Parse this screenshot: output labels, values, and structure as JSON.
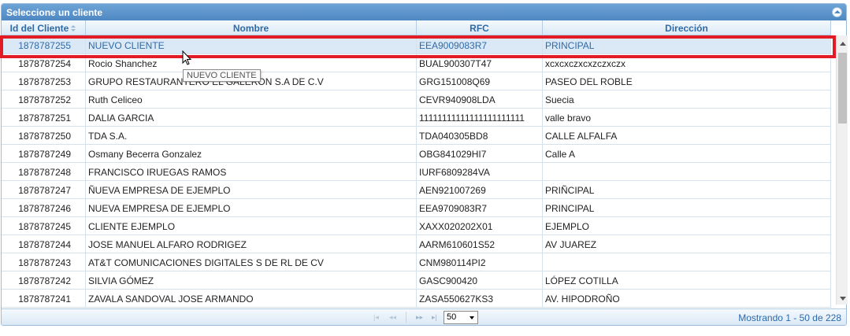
{
  "title": "Seleccione un cliente",
  "columns": {
    "id": "Id del Cliente",
    "name": "Nombre",
    "rfc": "RFC",
    "address": "Dirección"
  },
  "rows": [
    {
      "id": "1878787255",
      "name": "NUEVO CLIENTE",
      "rfc": "EEA9009083R7",
      "address": "PRINCIPAL",
      "selected": true
    },
    {
      "id": "1878787254",
      "name": "Rocio Shanchez",
      "rfc": "BUAL900307T47",
      "address": "xcxcxczxcxzczxczx"
    },
    {
      "id": "1878787253",
      "name": "GRUPO RESTAURANTERO EL GALERON S.A DE C.V",
      "rfc": "GRG151008Q69",
      "address": "PASEO DEL ROBLE"
    },
    {
      "id": "1878787252",
      "name": "Ruth Celiceo",
      "rfc": "CEVR940908LDA",
      "address": "Suecia"
    },
    {
      "id": "1878787251",
      "name": "DALIA GARCIA",
      "rfc": "11111111111111111111111",
      "address": "valle bravo"
    },
    {
      "id": "1878787250",
      "name": "TDA S.A.",
      "rfc": "TDA040305BD8",
      "address": "CALLE ALFALFA"
    },
    {
      "id": "1878787249",
      "name": "Osmany Becerra Gonzalez",
      "rfc": "OBG841029HI7",
      "address": "Calle A"
    },
    {
      "id": "1878787248",
      "name": "FRANCISCO IRUEGAS RAMOS",
      "rfc": "IURF6809284VA",
      "address": ""
    },
    {
      "id": "1878787247",
      "name": "ÑUEVA EMPRESA DE EJEMPLO",
      "rfc": "AEN921007269",
      "address": "PRIÑCIPAL"
    },
    {
      "id": "1878787246",
      "name": "NUEVA EMPRESA DE EJEMPLO",
      "rfc": "EEA9709083R7",
      "address": "PRINCIPAL"
    },
    {
      "id": "1878787245",
      "name": "CLIENTE EJEMPLO",
      "rfc": "XAXX020202X01",
      "address": "EJEMPLO"
    },
    {
      "id": "1878787244",
      "name": "JOSE MANUEL ALFARO RODRIGEZ",
      "rfc": "AARM610601S52",
      "address": "AV JUAREZ"
    },
    {
      "id": "1878787243",
      "name": "AT&T COMUNICACIONES DIGITALES S DE RL DE CV",
      "rfc": "CNM980114PI2",
      "address": ""
    },
    {
      "id": "1878787242",
      "name": "SILVIA GÓMEZ",
      "rfc": "GASC900420",
      "address": "LÓPEZ COTILLA"
    },
    {
      "id": "1878787241",
      "name": "ZAVALA SANDOVAL JOSE ARMANDO",
      "rfc": "ZASA550627KS3",
      "address": "AV. HIPODROÑO"
    }
  ],
  "tooltip": "NUEVO CLIENTE",
  "pager": {
    "page_size": "50",
    "info": "Mostrando 1 - 50 de 228"
  },
  "colors": {
    "header_text": "#2e6aa7",
    "title_bg": "#5a93cb",
    "selected_row": "#dbe9f7",
    "highlight": "#e21b25"
  },
  "icons": [
    "collapse-icon",
    "sort-icon",
    "first-page-icon",
    "prev-page-icon",
    "next-page-icon",
    "last-page-icon",
    "dropdown-arrow-icon",
    "mouse-cursor-icon"
  ]
}
